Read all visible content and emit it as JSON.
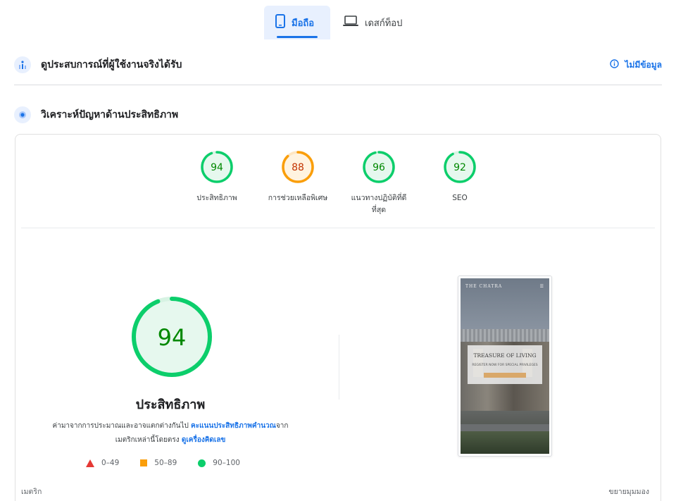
{
  "device_tabs": {
    "mobile_label": "มือถือ",
    "desktop_label": "เดสก์ท็อป",
    "active": "mobile"
  },
  "field_data": {
    "title": "ดูประสบการณ์ที่ผู้ใช้งานจริงได้รับ",
    "no_data_label": "ไม่มีข้อมูล",
    "icon": "people-chart-icon"
  },
  "diagnose": {
    "title": "วิเคราะห์ปัญหาด้านประสิทธิภาพ",
    "icon": "lighthouse-icon"
  },
  "categories": [
    {
      "label": "ประสิทธิภาพ",
      "score": 94,
      "score_text": "94",
      "status": "good"
    },
    {
      "label": "การช่วยเหลือพิเศษ",
      "score": 88,
      "score_text": "88",
      "status": "average"
    },
    {
      "label_line1": "แนวทางปฏิบัติที่ดี",
      "label_line2": "ที่สุด",
      "score": 96,
      "score_text": "96",
      "status": "good"
    },
    {
      "label": "SEO",
      "score": 92,
      "score_text": "92",
      "status": "good"
    }
  ],
  "performance": {
    "score": 94,
    "score_text": "94",
    "title": "ประสิทธิภาพ",
    "desc_part1": "ค่ามาจากการประมาณและอาจแตกต่างกันไป ",
    "desc_link1": "คะแนนประสิทธิภาพคำนวณ",
    "desc_part2": "จาก",
    "desc_part3": "เมตริกเหล่านี้โดยตรง ",
    "desc_link2": "ดูเครื่องคิดเลข"
  },
  "legend": [
    {
      "range": "0–49",
      "shape": "triangle",
      "color": "#e53935"
    },
    {
      "range": "50–89",
      "shape": "square",
      "color": "#fa9e0a"
    },
    {
      "range": "90–100",
      "shape": "circle",
      "color": "#0cce6b"
    }
  ],
  "screenshot": {
    "brand": "THE CHATRA",
    "headline": "TREASURE OF LIVING",
    "subline": "REGISTER NOW FOR SPECIAL PRIVILEGES"
  },
  "footer": {
    "metrics_label": "เมตริก",
    "expand_label": "ขยายมุมมอง"
  },
  "colors": {
    "good": "#0cce6b",
    "good_text": "#008800",
    "good_fill": "#e6f8ee",
    "average": "#fa9e0a",
    "average_text": "#c33300",
    "average_fill": "#fff3e0",
    "accent": "#1a73e8"
  }
}
